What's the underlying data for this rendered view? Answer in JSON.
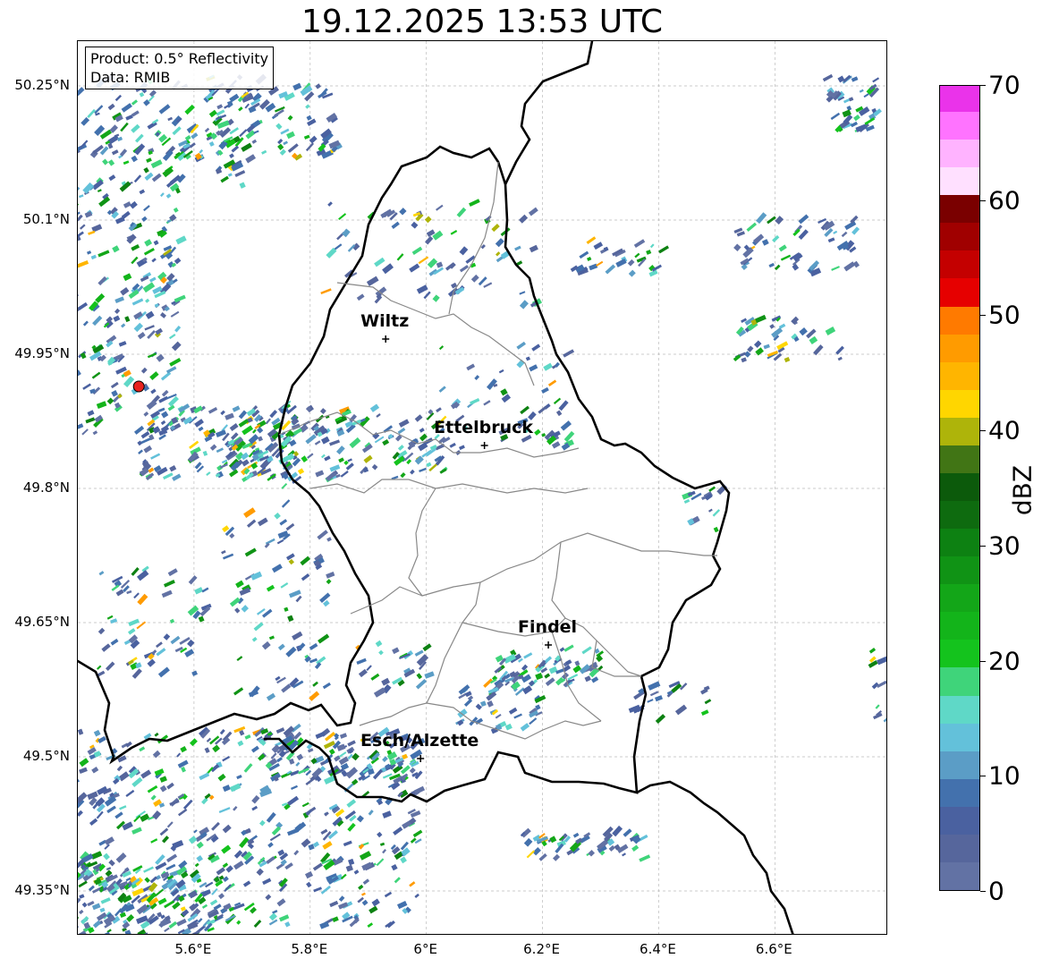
{
  "title": "19.12.2025 13:53 UTC",
  "info": {
    "product_line": "Product: 0.5° Reflectivity",
    "data_line": "Data: RMIB"
  },
  "map": {
    "latitude_ticks": [
      "50.25°N",
      "50.1°N",
      "49.95°N",
      "49.8°N",
      "49.65°N",
      "49.5°N",
      "49.35°N"
    ],
    "longitude_ticks": [
      "5.6°E",
      "5.8°E",
      "6°E",
      "6.2°E",
      "6.4°E",
      "6.6°E"
    ],
    "extent": {
      "lon_min": 5.4,
      "lon_max": 6.795,
      "lat_min": 49.3,
      "lat_max": 50.3
    },
    "radar_site": {
      "lon": 5.505,
      "lat": 49.914,
      "color": "#e8231f"
    },
    "cities": [
      {
        "name": "Wiltz",
        "lon": 5.93,
        "lat": 49.967
      },
      {
        "name": "Ettelbruck",
        "lon": 6.1,
        "lat": 49.848
      },
      {
        "name": "Findel",
        "lon": 6.21,
        "lat": 49.625
      },
      {
        "name": "Esch/Alzette",
        "lon": 5.99,
        "lat": 49.498
      }
    ],
    "grid": "dashed gray, on",
    "border_color": "#000000",
    "canton_border_color": "#888888"
  },
  "colorbar": {
    "label": "dBZ",
    "tick_labels": [
      "0",
      "10",
      "20",
      "30",
      "40",
      "50",
      "60",
      "70"
    ],
    "min": 0,
    "max": 70,
    "step": 2.5,
    "colors": [
      "#6272a4",
      "#56669c",
      "#4a61a0",
      "#4371ad",
      "#5b9dc6",
      "#63c1da",
      "#5fd8c7",
      "#3fd47a",
      "#14c31d",
      "#13b41a",
      "#13a618",
      "#109315",
      "#0d8112",
      "#0e6b0f",
      "#0c5a0b",
      "#417515",
      "#aeb40a",
      "#ffd600",
      "#ffb500",
      "#ff9b00",
      "#ff7a00",
      "#e60000",
      "#c40000",
      "#a00000",
      "#7a0000",
      "#ffe0ff",
      "#ffb3ff",
      "#ff73ff",
      "#ea33ea"
    ]
  }
}
